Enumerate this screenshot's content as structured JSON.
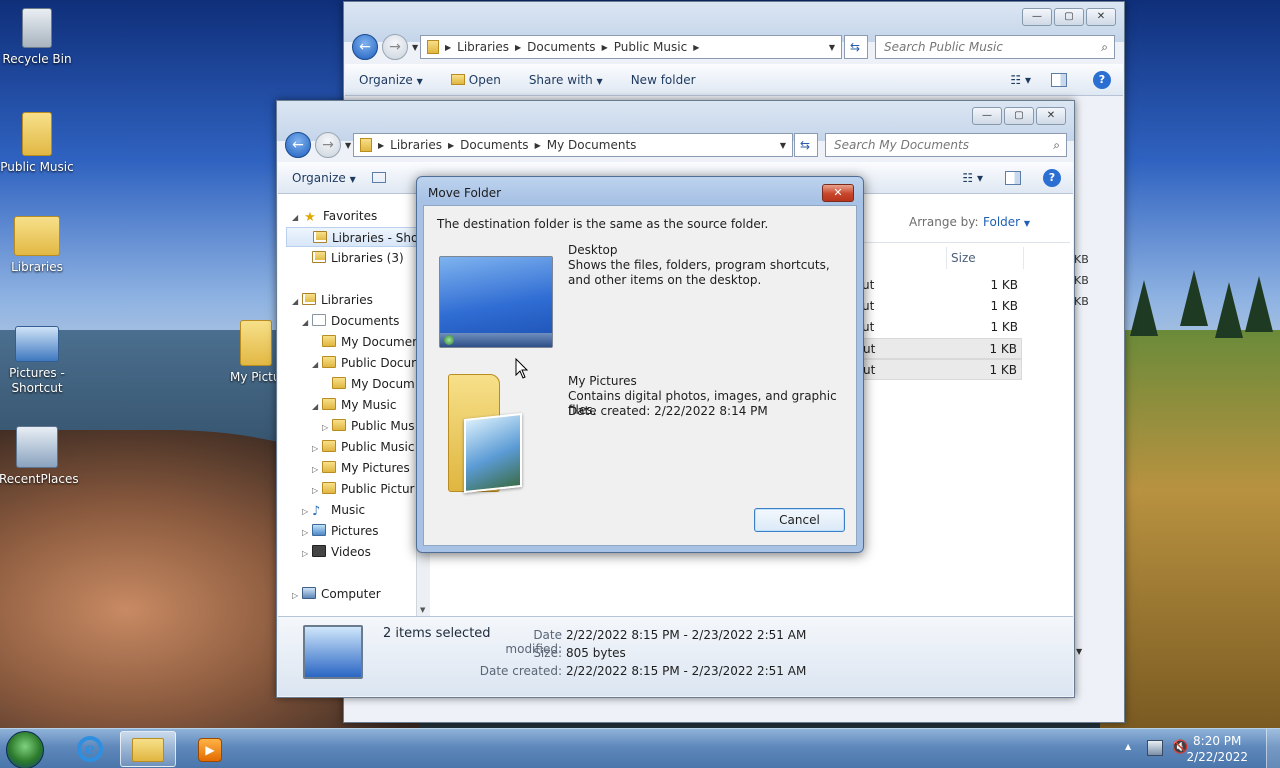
{
  "desktop": {
    "icons": [
      {
        "label": "Recycle Bin"
      },
      {
        "label": "Public Music"
      },
      {
        "label": "Libraries"
      },
      {
        "label": "Pictures - Shortcut"
      },
      {
        "label": "RecentPlaces"
      },
      {
        "label": "My Pictu"
      }
    ]
  },
  "back_window": {
    "breadcrumb": [
      "Libraries",
      "Documents",
      "Public Music"
    ],
    "search_placeholder": "Search Public Music",
    "toolbar": {
      "organize": "Organize",
      "open": "Open",
      "share_with": "Share with",
      "new_folder": "New folder"
    },
    "size_values": [
      "KB",
      "KB",
      "KB"
    ]
  },
  "front_window": {
    "breadcrumb": [
      "Libraries",
      "Documents",
      "My Documents"
    ],
    "search_placeholder": "Search My Documents",
    "toolbar": {
      "organize": "Organize"
    },
    "arrange_label": "Arrange by:",
    "arrange_value": "Folder",
    "column_size": "Size",
    "rows": [
      {
        "name": "ut",
        "size": "1 KB"
      },
      {
        "name": "ut",
        "size": "1 KB"
      },
      {
        "name": "ut",
        "size": "1 KB"
      },
      {
        "name": "ut",
        "size": "1 KB"
      },
      {
        "name": "ut",
        "size": "1 KB"
      }
    ],
    "nav": {
      "favorites": "Favorites",
      "libraries_shortcut": "Libraries - Shor",
      "libraries_3": "Libraries (3)",
      "libraries": "Libraries",
      "documents": "Documents",
      "my_documents": "My Documer",
      "public_documents": "Public Docur",
      "my_documents_sub": "My Docum",
      "my_music": "My Music",
      "public_music_sub": "Public Mus",
      "public_music": "Public Music",
      "my_pictures": "My Pictures",
      "public_pictures": "Public Pictur",
      "music": "Music",
      "pictures": "Pictures",
      "videos": "Videos",
      "computer": "Computer"
    },
    "status": {
      "selected": "2 items selected",
      "date_modified_label": "Date modified:",
      "date_modified_value": "2/22/2022 8:15 PM - 2/23/2022 2:51 AM",
      "size_label": "Size:",
      "size_value": "805 bytes",
      "date_created_label": "Date created:",
      "date_created_value": "2/22/2022 8:15 PM - 2/23/2022 2:51 AM"
    }
  },
  "dialog": {
    "title": "Move Folder",
    "message": "The destination folder is the same as the source folder.",
    "dest": {
      "name": "Desktop",
      "desc": "Shows the files, folders, program shortcuts, and other items on the desktop."
    },
    "source": {
      "name": "My Pictures",
      "desc": "Contains digital photos, images, and graphic files.",
      "date": "Date created: 2/22/2022 8:14 PM"
    },
    "cancel": "Cancel"
  },
  "taskbar": {
    "time": "8:20 PM",
    "date": "2/22/2022"
  },
  "colors": {
    "accent": "#2a6fd1",
    "close_red": "#c7452a"
  }
}
